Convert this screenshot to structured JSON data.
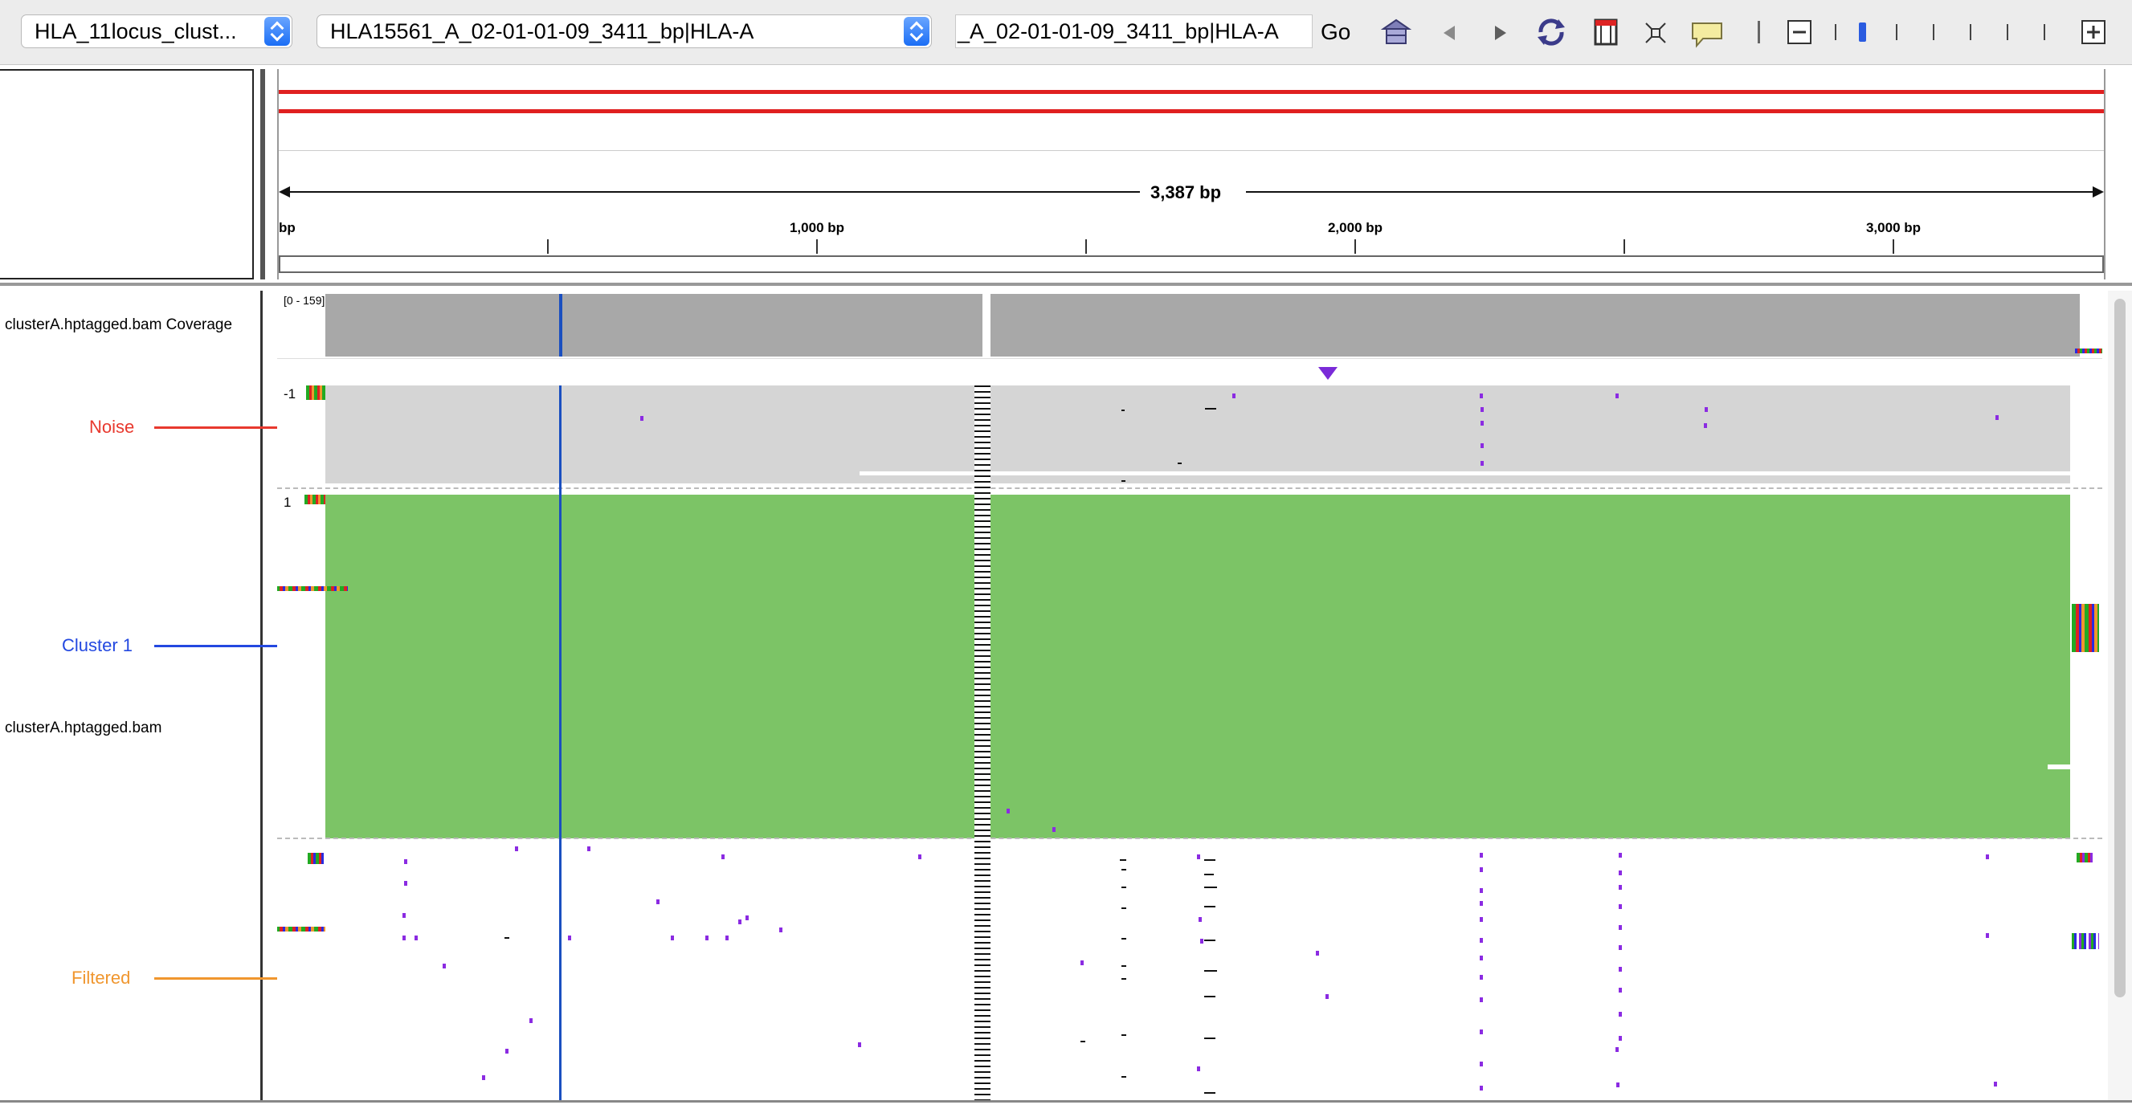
{
  "toolbar": {
    "genome_select": "HLA_11locus_clust...",
    "chromosome_select": "HLA15561_A_02-01-01-09_3411_bp|HLA-A",
    "locus_input": "_A_02-01-01-09_3411_bp|HLA-A",
    "go_label": "Go",
    "icons": [
      "home-icon",
      "back-icon",
      "forward-icon",
      "refresh-icon",
      "region-of-interest-icon",
      "resize-icon",
      "popup-text-icon",
      "zoom-out-icon",
      "zoom-slider",
      "zoom-in-icon"
    ]
  },
  "ruler": {
    "span_label": "3,387 bp",
    "start_label": "bp",
    "tick_labels": [
      "1,000 bp",
      "2,000 bp",
      "3,000 bp"
    ]
  },
  "tracks": {
    "coverage_name": "clusterA.hptagged.bam Coverage",
    "coverage_range": "[0 - 159]",
    "alignment_name": "clusterA.hptagged.bam",
    "group_noise_tag": "-1",
    "group_cluster_tag": "1"
  },
  "annotations": {
    "noise": "Noise",
    "cluster": "Cluster 1",
    "filtered": "Filtered"
  },
  "colors": {
    "noise_label": "#e8392e",
    "cluster_label": "#2348e0",
    "filtered_label": "#f0962e",
    "read_green": "#7cc466",
    "read_gray": "#d5d5d5",
    "coverage_gray": "#a8a8a8",
    "ideogram_red": "#e02020",
    "mismatch_purple": "#8b2be2"
  }
}
